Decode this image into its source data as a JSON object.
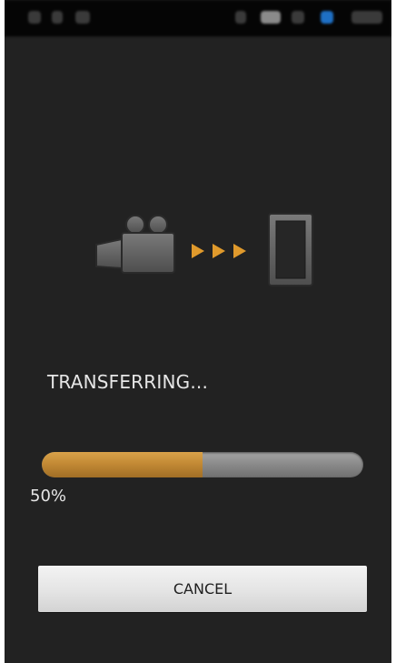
{
  "status_bar": {
    "icons": [
      "notification-icon",
      "notification-icon",
      "notification-icon",
      "signal-icon",
      "wifi-icon",
      "battery-icon",
      "bluetooth-icon",
      "clock-icon"
    ]
  },
  "transfer_graphic": {
    "source_icon": "video-camera-icon",
    "direction_icon": "triple-arrow-right-icon",
    "target_icon": "smartphone-icon",
    "arrow_color": "#e09a2c"
  },
  "status_text": "TRANSFERRING...",
  "progress": {
    "fraction": 0.5,
    "percent_label": "50%",
    "fill_color": "#c38a35",
    "track_color": "#8c8c8c"
  },
  "cancel_button": {
    "label": "CANCEL"
  },
  "colors": {
    "background": "#222222",
    "accent": "#e09a2c",
    "text": "#e6e6e6"
  }
}
